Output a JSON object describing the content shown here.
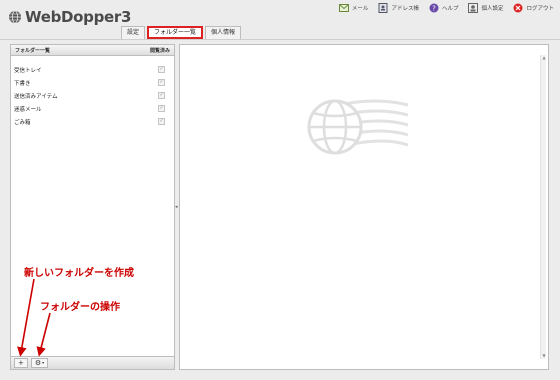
{
  "app": {
    "title": "WebDopper3"
  },
  "topnav": {
    "items": [
      {
        "label": "メール",
        "icon": "mail-icon"
      },
      {
        "label": "アドレス帳",
        "icon": "address-book-icon"
      },
      {
        "label": "ヘルプ",
        "icon": "help-icon"
      },
      {
        "label": "個人設定",
        "icon": "personal-settings-icon"
      },
      {
        "label": "ログアウト",
        "icon": "logout-icon"
      }
    ]
  },
  "tabs": [
    {
      "label": "設定",
      "active": false
    },
    {
      "label": "フォルダー一覧",
      "active": true
    },
    {
      "label": "個人情報",
      "active": false
    }
  ],
  "folder_panel": {
    "col_name": "フォルダー一覧",
    "col_read": "閲覧済み",
    "folders": [
      {
        "name": "受信トレイ",
        "checked": true
      },
      {
        "name": "下書き",
        "checked": true
      },
      {
        "name": "送信済みアイテム",
        "checked": true
      },
      {
        "name": "迷惑メール",
        "checked": true
      },
      {
        "name": "ごみ箱",
        "checked": true
      }
    ],
    "footer": {
      "add_label": "+",
      "gear_label": "⚙",
      "caret": "▾"
    }
  },
  "annotations": {
    "new_folder": "新しいフォルダーを作成",
    "folder_ops": "フォルダーの操作",
    "color": "#cc0000"
  },
  "colors": {
    "active_tab_border": "#dd2222",
    "annotation": "#cc0000"
  }
}
